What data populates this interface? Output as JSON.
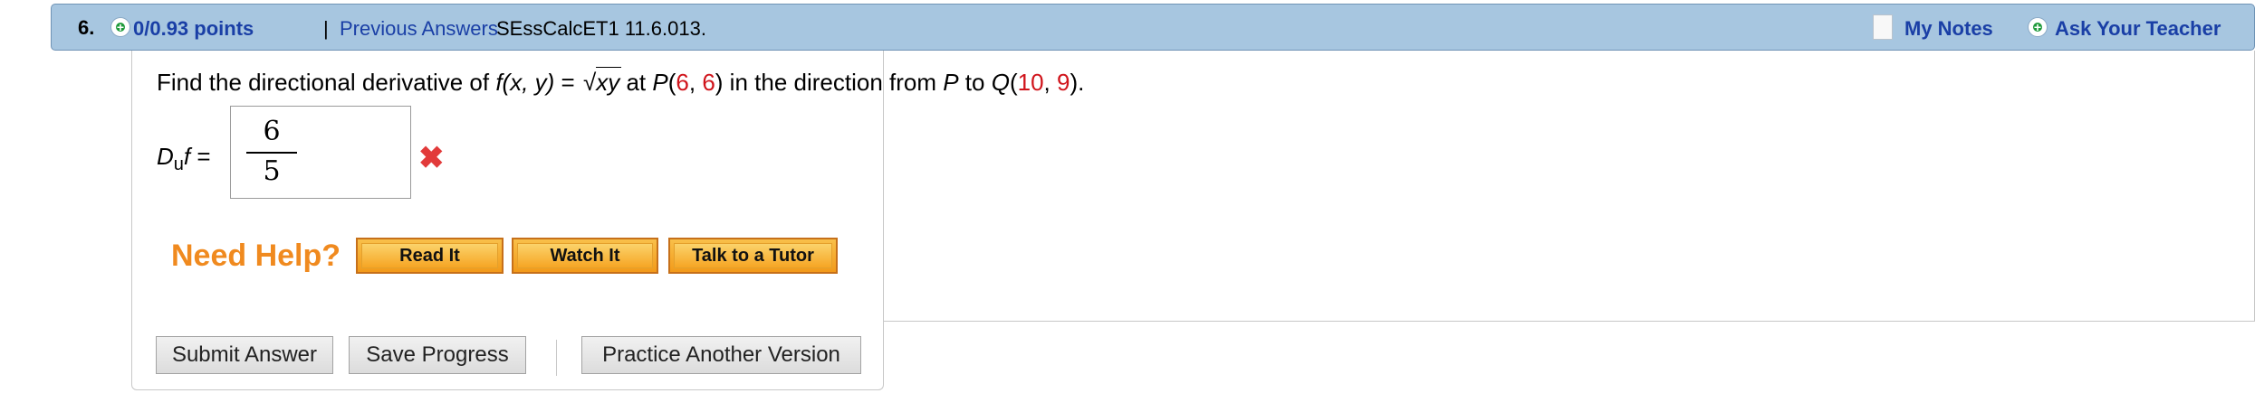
{
  "header": {
    "question_number": "6.",
    "points": "0/0.93 points",
    "separator": "|",
    "previous_answers": "Previous Answers",
    "question_id": "SEssCalcET1 11.6.013.",
    "my_notes": "My Notes",
    "ask_teacher": "Ask Your Teacher"
  },
  "question": {
    "prefix": "Find the directional derivative of ",
    "f": "f",
    "args": "(x, y)",
    "equals": " = ",
    "radical": "√",
    "radicand": "xy",
    "at": " at ",
    "P": "P",
    "open": "(",
    "p1": "6",
    "comma": ", ",
    "p2": "6",
    "close": ")",
    "mid": " in the direction from ",
    "P2": "P",
    "to": " to ",
    "Q": "Q",
    "q1": "10",
    "q2": "9",
    "end": ")."
  },
  "answer": {
    "label_d": "D",
    "label_sub": "u",
    "label_f": "f",
    "label_eq": " =",
    "numerator": "6",
    "denominator": "5",
    "status": "incorrect"
  },
  "help": {
    "title": "Need Help?",
    "buttons": [
      "Read It",
      "Watch It",
      "Talk to a Tutor"
    ]
  },
  "actions": {
    "submit": "Submit Answer",
    "save": "Save Progress",
    "practice": "Practice Another Version"
  },
  "colors": {
    "header_bg": "#a7c6e0",
    "link": "#1a3fa6",
    "highlight": "#d0141b",
    "help_orange": "#f08a1f",
    "incorrect": "#e23a3a"
  }
}
